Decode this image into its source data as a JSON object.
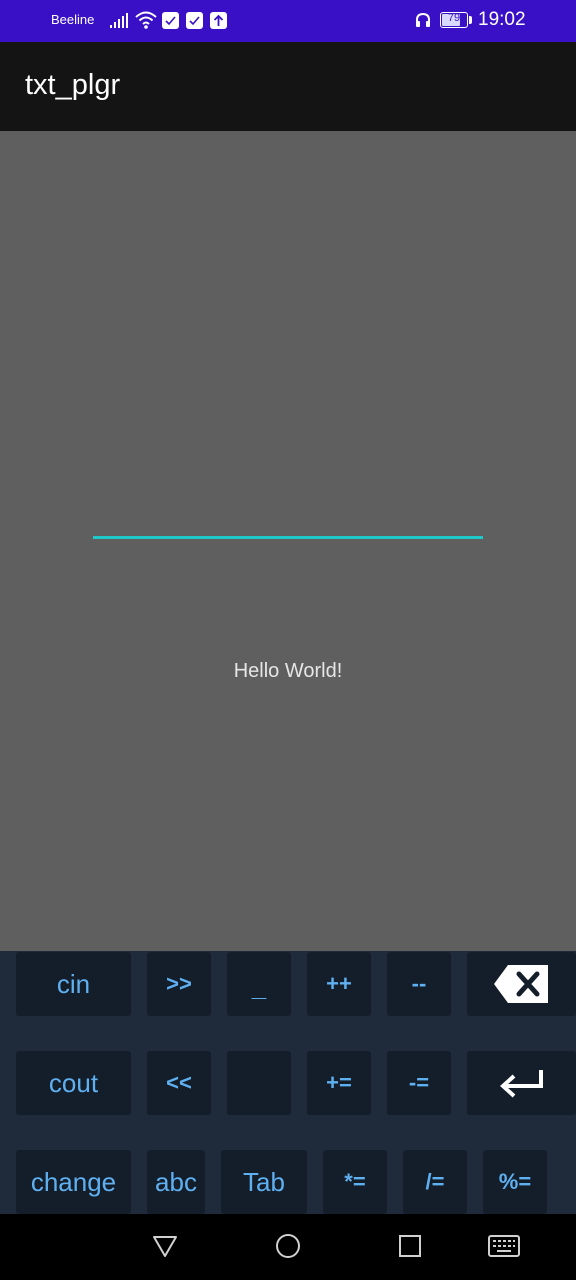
{
  "status_bar": {
    "carrier": "Beeline",
    "battery_level": "79",
    "battery_percent": 79,
    "time": "19:02",
    "color": "#3a10c6"
  },
  "app_bar": {
    "title": "txt_plgr"
  },
  "content": {
    "input_value": "",
    "hello_text": "Hello World!",
    "accent_color": "#1ec8c8"
  },
  "keyboard": {
    "key_color": "#5fb0f0",
    "row1": [
      "cin",
      ">>",
      "_",
      "++",
      "--"
    ],
    "row2": [
      "cout",
      "<<",
      "",
      "+=",
      "-="
    ],
    "row3": [
      "change",
      "abc",
      "Tab",
      "*=",
      "/=",
      "%="
    ],
    "backspace_icon": "backspace-icon",
    "enter_icon": "enter-icon"
  },
  "nav_bar": {
    "icons": [
      "back-triangle-icon",
      "home-circle-icon",
      "recents-square-icon",
      "keyboard-icon"
    ]
  }
}
